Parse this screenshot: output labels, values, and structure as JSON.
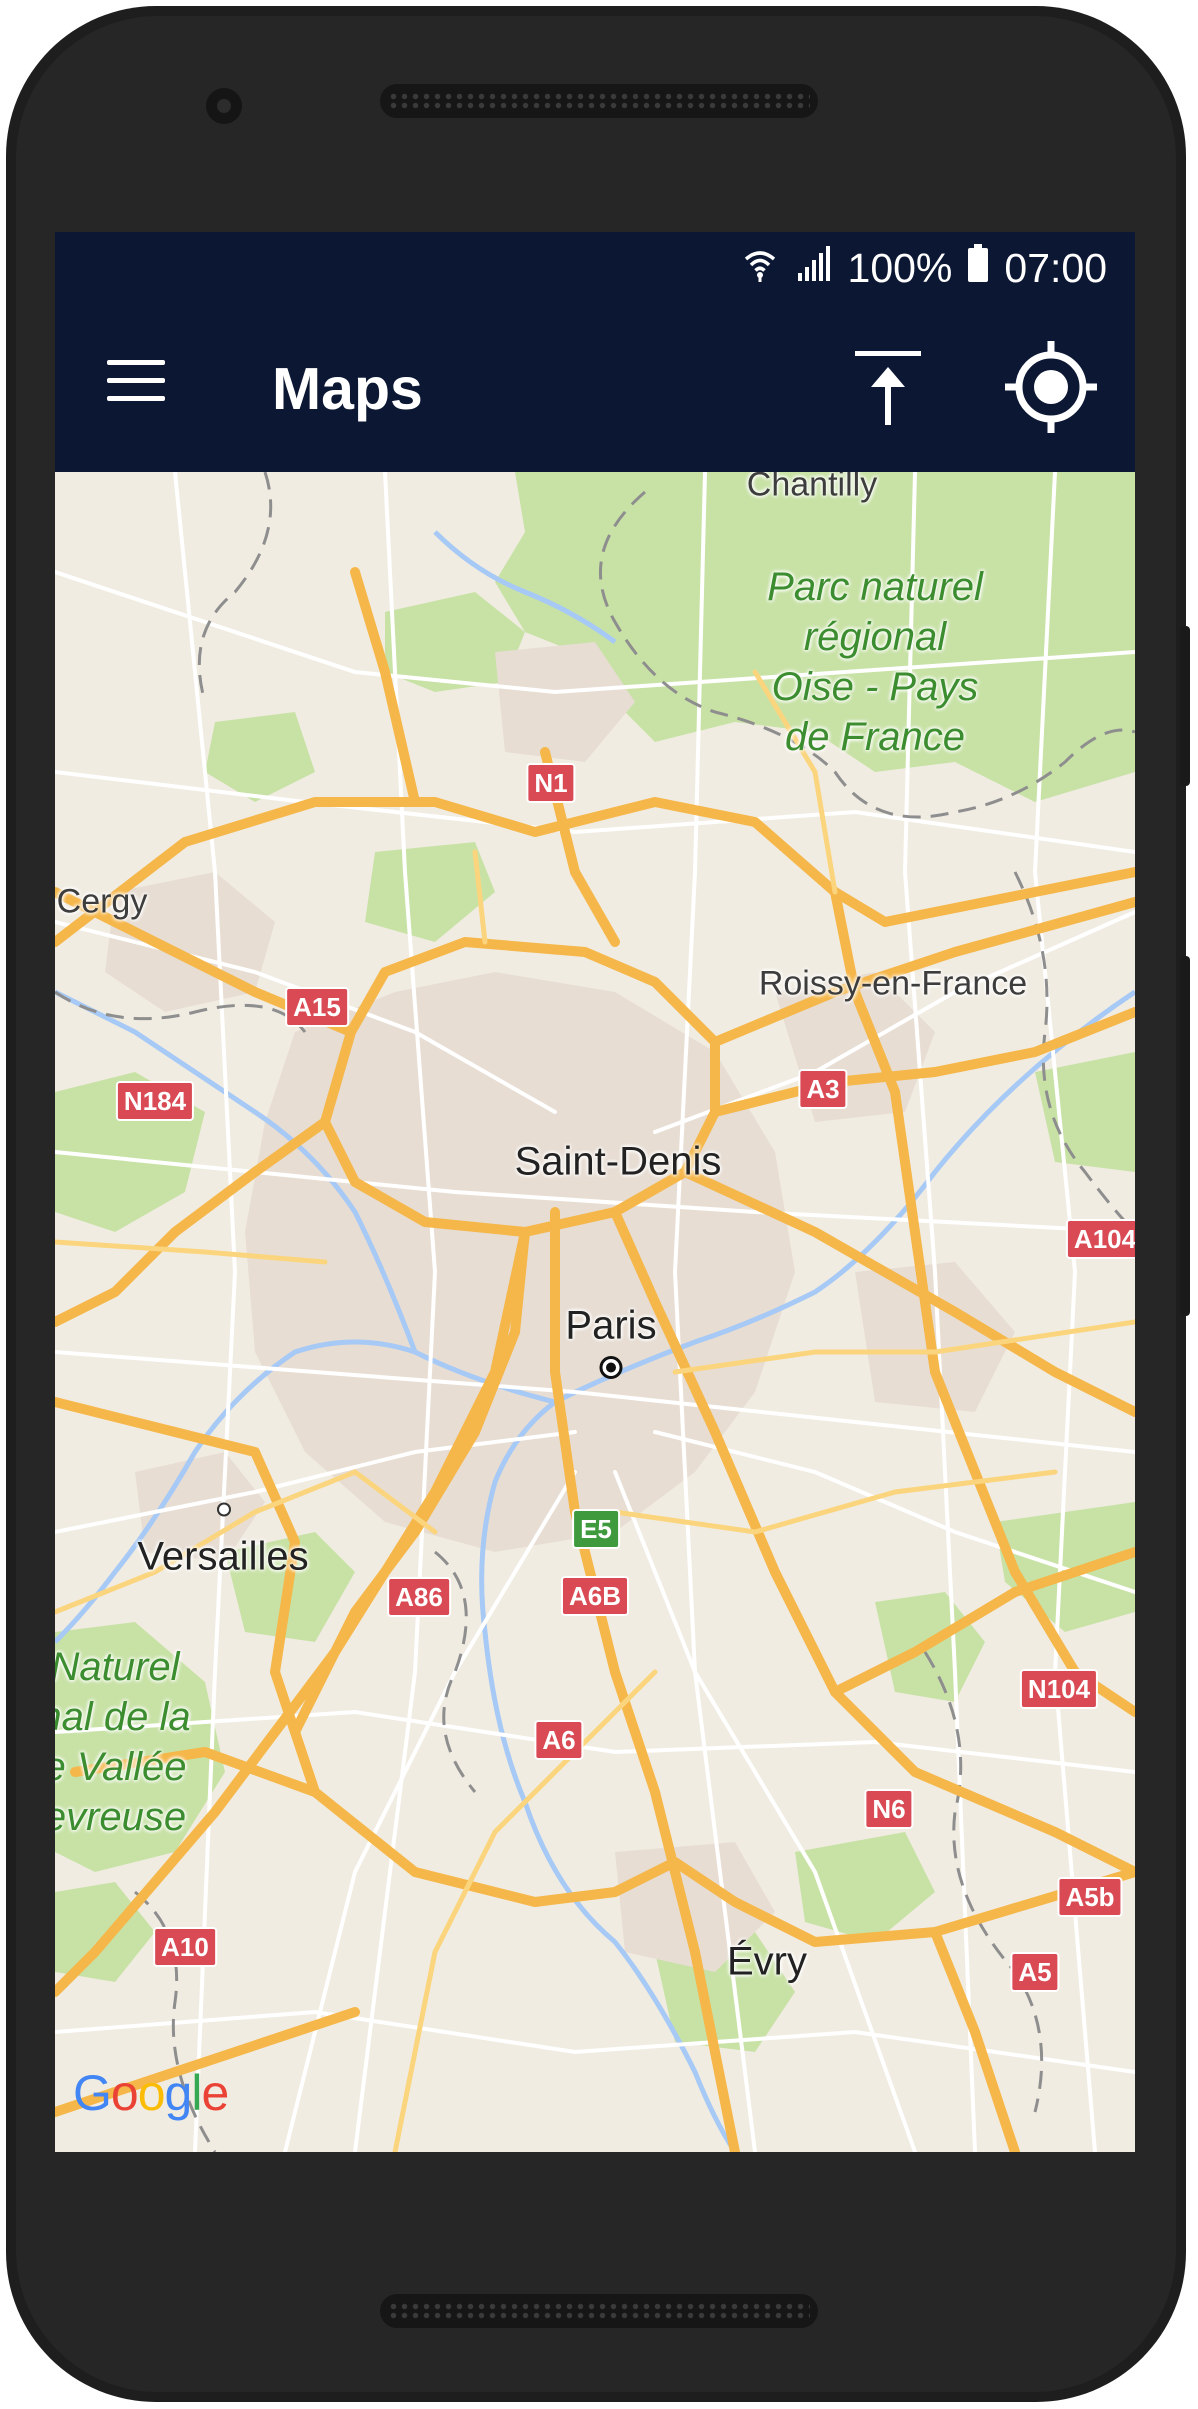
{
  "status_bar": {
    "battery": "100%",
    "time": "07:00",
    "icons": [
      "wifi-icon",
      "signal-icon",
      "battery-icon"
    ]
  },
  "app_bar": {
    "title": "Maps",
    "actions": [
      "menu-icon",
      "upload-icon",
      "my-location-icon"
    ]
  },
  "map": {
    "places": {
      "chantilly": "Chantilly",
      "cergy": "Cergy",
      "roissy": "Roissy-en-France",
      "saint_denis": "Saint-Denis",
      "paris": "Paris",
      "versailles": "Versailles",
      "evry": "Évry"
    },
    "parks": {
      "oise_line1": "Parc naturel",
      "oise_line2": "régional",
      "oise_line3": "Oise - Pays",
      "oise_line4": "de France",
      "chevreuse_line1": "Naturel",
      "chevreuse_line2": "nal de la",
      "chevreuse_line3": "e Vallée",
      "chevreuse_line4": "evreuse"
    },
    "road_shields": {
      "n1": "N1",
      "a15": "A15",
      "n184": "N184",
      "a3": "A3",
      "a104": "A104",
      "e5": "E5",
      "a86": "A86",
      "a6b": "A6B",
      "n104": "N104",
      "a6": "A6",
      "n6": "N6",
      "a5b": "A5b",
      "a10": "A10",
      "a5": "A5"
    },
    "attribution": "Google",
    "colors": {
      "land": "#f1ece2",
      "park": "#c8e2a6",
      "urban": "#e7ddd3",
      "major_road": "#f5b74a",
      "minor_road": "#ffffff",
      "water": "#a6c9f5",
      "shield_red": "#d94a54",
      "shield_green": "#3f9a3d"
    }
  },
  "theme": {
    "app_bar_color": "#0c1733"
  }
}
